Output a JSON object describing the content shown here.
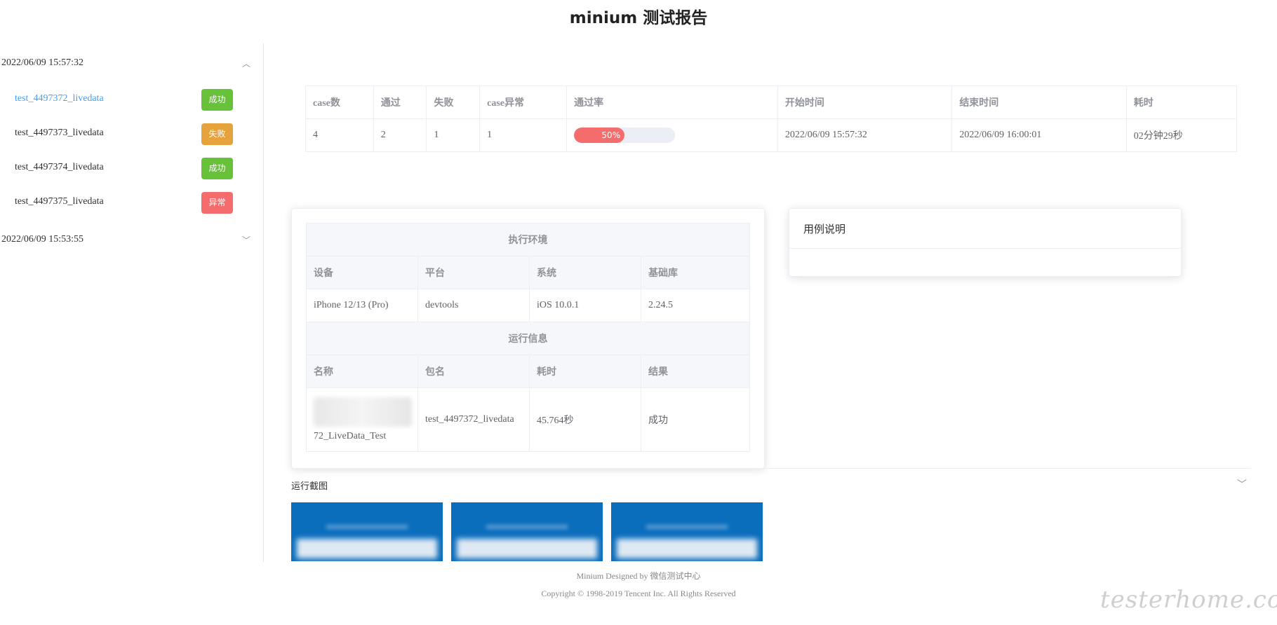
{
  "title": "minium 测试报告",
  "sidebar": {
    "groups": [
      {
        "timestamp": "2022/06/09 15:57:32",
        "expanded": true,
        "cases": [
          {
            "name": "test_4497372_livedata",
            "status": "成功",
            "status_color": "#67c23a",
            "active": true
          },
          {
            "name": "test_4497373_livedata",
            "status": "失败",
            "status_color": "#e6a23c",
            "active": false
          },
          {
            "name": "test_4497374_livedata",
            "status": "成功",
            "status_color": "#67c23a",
            "active": false
          },
          {
            "name": "test_4497375_livedata",
            "status": "异常",
            "status_color": "#f56c6c",
            "active": false
          }
        ]
      },
      {
        "timestamp": "2022/06/09 15:53:55",
        "expanded": false
      }
    ]
  },
  "summary": {
    "headers": [
      "case数",
      "通过",
      "失败",
      "case异常",
      "通过率",
      "开始时间",
      "结束时间",
      "耗时"
    ],
    "values": {
      "case_count": "4",
      "passed": "2",
      "failed": "1",
      "errors": "1",
      "pass_rate_label": "50%",
      "pass_rate": 0.5,
      "start_time": "2022/06/09 15:57:32",
      "end_time": "2022/06/09 16:00:01",
      "duration": "02分钟29秒"
    }
  },
  "env": {
    "section_title": "执行环境",
    "headers": [
      "设备",
      "平台",
      "系统",
      "基础库"
    ],
    "values": [
      "iPhone 12/13 (Pro)",
      "devtools",
      "iOS 10.0.1",
      "2.24.5"
    ]
  },
  "run": {
    "section_title": "运行信息",
    "headers": [
      "名称",
      "包名",
      "耗时",
      "结果"
    ],
    "name_suffix": "72_LiveData_Test",
    "package": "test_4497372_livedata",
    "duration": "45.764秒",
    "result": "成功"
  },
  "description": {
    "title": "用例说明"
  },
  "screenshots": {
    "label": "运行截图",
    "count": 3
  },
  "footer": {
    "designed": "Minium Designed by 微信测试中心",
    "copyright": "Copyright © 1998-2019 Tencent Inc. All Rights Reserved"
  },
  "watermark": "testerhome.com",
  "colors": {
    "accent": "#409eff",
    "success": "#67c23a",
    "warning": "#e6a23c",
    "danger": "#f56c6c"
  }
}
